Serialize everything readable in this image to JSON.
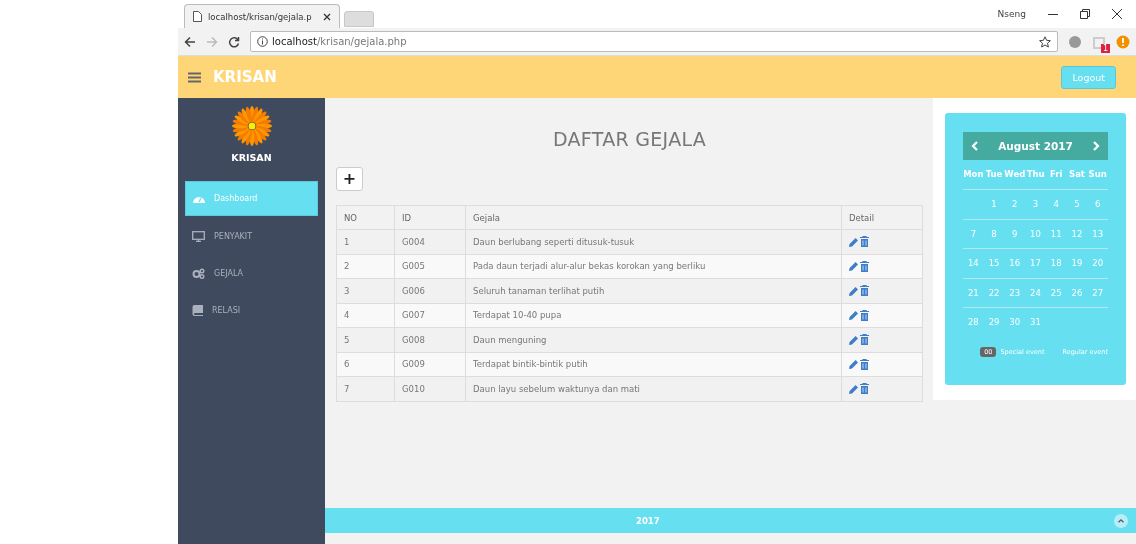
{
  "browser": {
    "tab_title": "localhost/krisan/gejala.p",
    "profile_name": "Nseng",
    "address": {
      "host": "localhost",
      "path": "/krisan/gejala.php"
    },
    "extension_badge": "1"
  },
  "header": {
    "brand": "KRISAN",
    "logout": "Logout"
  },
  "sidebar": {
    "brand": "KRISAN",
    "items": [
      {
        "label": "Dashboard",
        "selected": true
      },
      {
        "label": "PENYAKIT",
        "selected": false
      },
      {
        "label": "GEJALA",
        "selected": false
      },
      {
        "label": "RELASI",
        "selected": false
      }
    ]
  },
  "page_title": "DAFTAR GEJALA",
  "add_button": "+",
  "table": {
    "columns": [
      "NO",
      "ID",
      "Gejala",
      "Detail"
    ],
    "rows": [
      {
        "no": "1",
        "id": "G004",
        "gejala": "Daun berlubang seperti ditusuk-tusuk"
      },
      {
        "no": "2",
        "id": "G005",
        "gejala": "Pada daun terjadi alur-alur bekas korokan yang berliku"
      },
      {
        "no": "3",
        "id": "G006",
        "gejala": "Seluruh tanaman terlihat putih"
      },
      {
        "no": "4",
        "id": "G007",
        "gejala": "Terdapat 10-40 pupa"
      },
      {
        "no": "5",
        "id": "G008",
        "gejala": "Daun menguning"
      },
      {
        "no": "6",
        "id": "G009",
        "gejala": "Terdapat bintik-bintik putih"
      },
      {
        "no": "7",
        "id": "G010",
        "gejala": "Daun layu sebelum waktunya dan mati"
      }
    ]
  },
  "calendar": {
    "month": "August 2017",
    "weekdays": [
      "Mon",
      "Tue",
      "Wed",
      "Thu",
      "Fri",
      "Sat",
      "Sun"
    ],
    "weeks": [
      [
        "1",
        "2",
        "3",
        "4",
        "5",
        "6"
      ],
      [
        "7",
        "8",
        "9",
        "10",
        "11",
        "12",
        "13"
      ],
      [
        "14",
        "15",
        "16",
        "17",
        "18",
        "19",
        "20"
      ],
      [
        "21",
        "22",
        "23",
        "24",
        "25",
        "26",
        "27"
      ],
      [
        "28",
        "29",
        "30",
        "31"
      ]
    ],
    "legend": {
      "badge": "00",
      "special": "Special event",
      "regular": "Regular event"
    }
  },
  "footer": {
    "year": "2017"
  }
}
